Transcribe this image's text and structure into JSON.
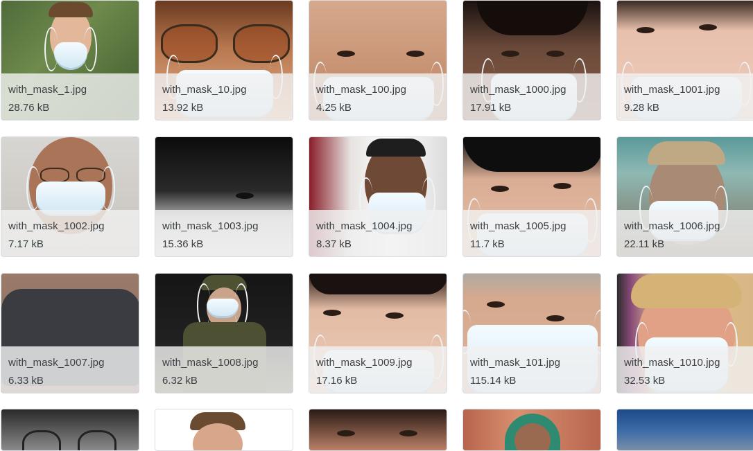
{
  "files": [
    {
      "name": "with_mask_1.jpg",
      "size": "28.76 kB"
    },
    {
      "name": "with_mask_10.jpg",
      "size": "13.92 kB"
    },
    {
      "name": "with_mask_100.jpg",
      "size": "4.25 kB"
    },
    {
      "name": "with_mask_1000.jpg",
      "size": "17.91 kB"
    },
    {
      "name": "with_mask_1001.jpg",
      "size": "9.28 kB"
    },
    {
      "name": "with_mask_1002.jpg",
      "size": "7.17 kB"
    },
    {
      "name": "with_mask_1003.jpg",
      "size": "15.36 kB"
    },
    {
      "name": "with_mask_1004.jpg",
      "size": "8.37 kB"
    },
    {
      "name": "with_mask_1005.jpg",
      "size": "11.7 kB"
    },
    {
      "name": "with_mask_1006.jpg",
      "size": "22.11 kB"
    },
    {
      "name": "with_mask_1007.jpg",
      "size": "6.33 kB"
    },
    {
      "name": "with_mask_1008.jpg",
      "size": "6.32 kB"
    },
    {
      "name": "with_mask_1009.jpg",
      "size": "17.16 kB"
    },
    {
      "name": "with_mask_101.jpg",
      "size": "115.14 kB"
    },
    {
      "name": "with_mask_1010.jpg",
      "size": "32.53 kB"
    }
  ]
}
